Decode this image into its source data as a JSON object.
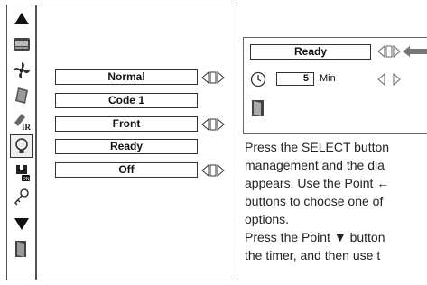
{
  "menu": {
    "icons": [
      {
        "name": "arrow-up-icon",
        "selected": false
      },
      {
        "name": "image-adjust-icon",
        "selected": false
      },
      {
        "name": "fan-icon",
        "selected": false
      },
      {
        "name": "screen-icon",
        "selected": false
      },
      {
        "name": "ir-remote-icon",
        "selected": false
      },
      {
        "name": "lamp-icon",
        "selected": true
      },
      {
        "name": "power-on-icon",
        "selected": false
      },
      {
        "name": "key-icon",
        "selected": false
      },
      {
        "name": "arrow-down-icon",
        "selected": false
      },
      {
        "name": "exit-door-icon",
        "selected": false
      }
    ]
  },
  "main": {
    "rows": [
      {
        "label": "Normal",
        "has_arrows": true
      },
      {
        "label": "Code 1",
        "has_arrows": false
      },
      {
        "label": "Front",
        "has_arrows": true
      },
      {
        "label": "Ready",
        "has_arrows": false
      },
      {
        "label": "Off",
        "has_arrows": true
      }
    ]
  },
  "dialog": {
    "mode_value": "Ready",
    "timer_value": "5",
    "timer_unit": "Min"
  },
  "instructions": {
    "line1": "Press the SELECT button",
    "line2": "management and the dia",
    "line3": "appears.  Use the Point ←",
    "line4": "buttons to choose one of",
    "line5": "options.",
    "line6": "Press the Point ▼ button",
    "line7": "the timer, and then use t"
  }
}
